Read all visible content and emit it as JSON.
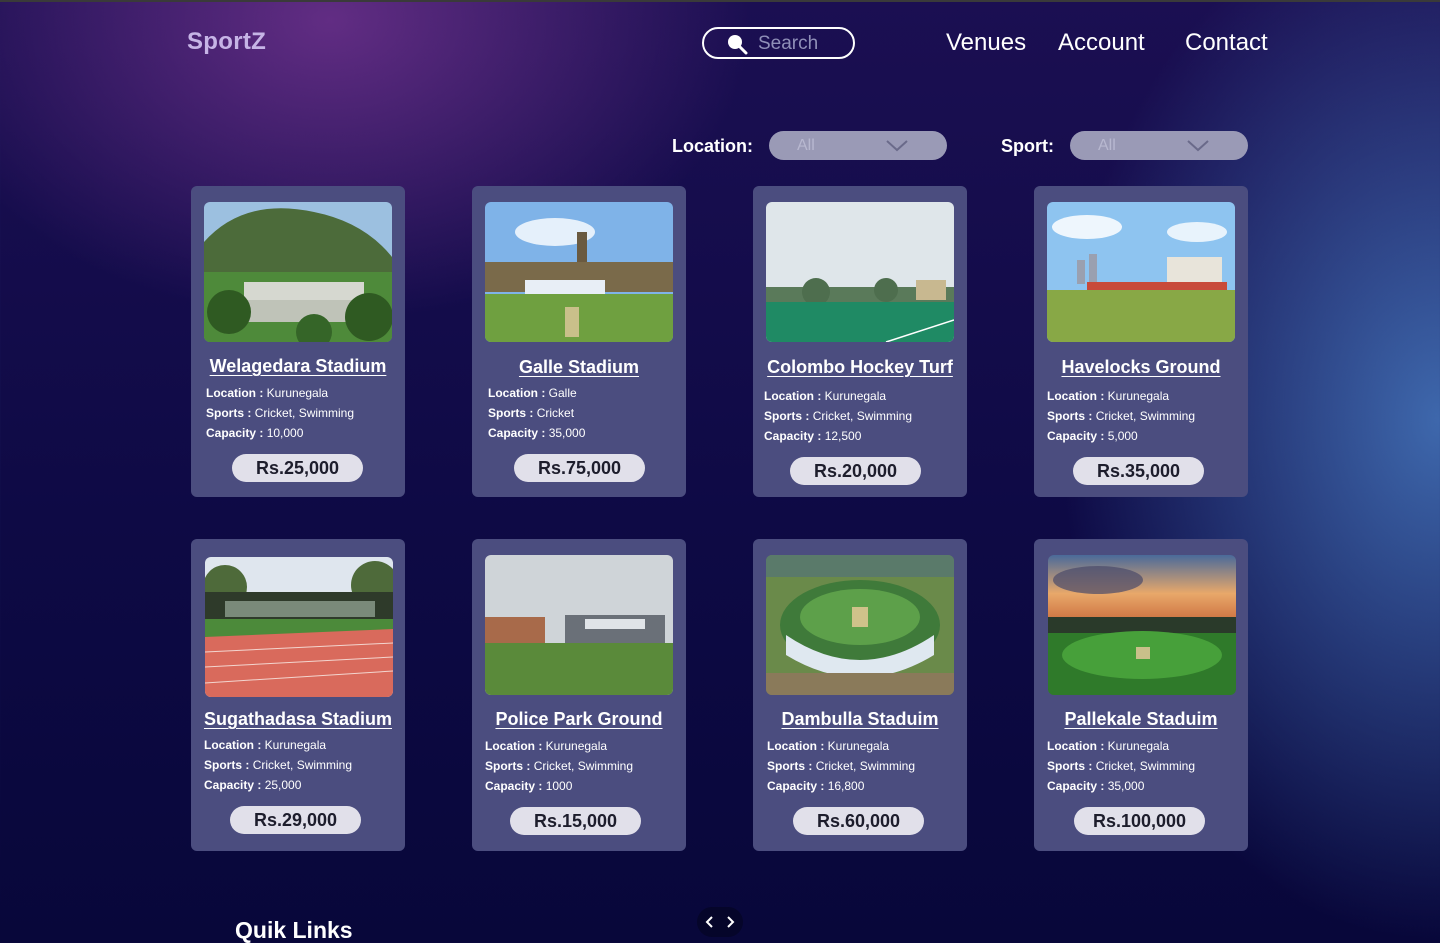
{
  "app": {
    "brand": "SportZ"
  },
  "search": {
    "placeholder": "Search"
  },
  "nav": {
    "items": [
      "Venues",
      "Account",
      "Contact"
    ]
  },
  "filters": {
    "location": {
      "label": "Location:",
      "value": "All"
    },
    "sport": {
      "label": "Sport:",
      "value": "All"
    }
  },
  "labels": {
    "location": "Location :",
    "sports": "Sports :",
    "capacity": "Capacity :"
  },
  "venues": [
    {
      "name": "Welagedara Stadium",
      "location": "Kurunegala",
      "sports": "Cricket, Swimming",
      "capacity": "10,000",
      "price": "Rs.25,000"
    },
    {
      "name": "Galle Stadium",
      "location": "Galle",
      "sports": "Cricket",
      "capacity": "35,000",
      "price": "Rs.75,000"
    },
    {
      "name": "Colombo Hockey Turf",
      "location": "Kurunegala",
      "sports": "Cricket, Swimming",
      "capacity": "12,500",
      "price": "Rs.20,000"
    },
    {
      "name": "Havelocks Ground",
      "location": "Kurunegala",
      "sports": "Cricket, Swimming",
      "capacity": "5,000",
      "price": "Rs.35,000"
    },
    {
      "name": "Sugathadasa Stadium",
      "location": "Kurunegala",
      "sports": "Cricket, Swimming",
      "capacity": "25,000",
      "price": "Rs.29,000"
    },
    {
      "name": "Police Park Ground",
      "location": "Kurunegala",
      "sports": "Cricket, Swimming",
      "capacity": "1000",
      "price": "Rs.15,000"
    },
    {
      "name": "Dambulla Staduim",
      "location": "Kurunegala",
      "sports": "Cricket, Swimming",
      "capacity": "16,800",
      "price": "Rs.60,000"
    },
    {
      "name": "Pallekale Staduim",
      "location": "Kurunegala",
      "sports": "Cricket, Swimming",
      "capacity": "35,000",
      "price": "Rs.100,000"
    }
  ],
  "footer": {
    "quick_links_title": "Quik Links"
  },
  "icons": {
    "search": "search-icon",
    "dropdown": "chevron-down-icon",
    "prev": "chevron-left-icon",
    "next": "chevron-right-icon"
  },
  "colors": {
    "card": "#4b4d7f",
    "price_pill": "#e1e0ea",
    "brand": "#c6b4e6"
  }
}
